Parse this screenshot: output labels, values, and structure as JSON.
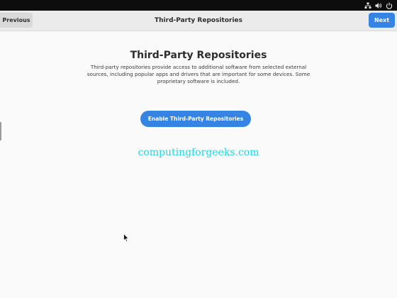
{
  "system_tray": {
    "icons": [
      "network-icon",
      "volume-icon",
      "power-icon"
    ]
  },
  "header": {
    "title": "Third-Party Repositories",
    "previous_label": "Previous",
    "next_label": "Next"
  },
  "main": {
    "heading": "Third-Party Repositories",
    "description": "Third-party repositories provide access to additional software from selected external sources, including popular apps and drivers that are important for some devices. Some proprietary software is included.",
    "enable_button_label": "Enable Third-Party Repositories"
  },
  "watermark": "computingforgeeks.com",
  "colors": {
    "accent": "#3584e4",
    "topbar": "#0d0d0d",
    "headerbar": "#ebebeb",
    "background": "#fafafa",
    "watermark": "#1ed7e0"
  }
}
